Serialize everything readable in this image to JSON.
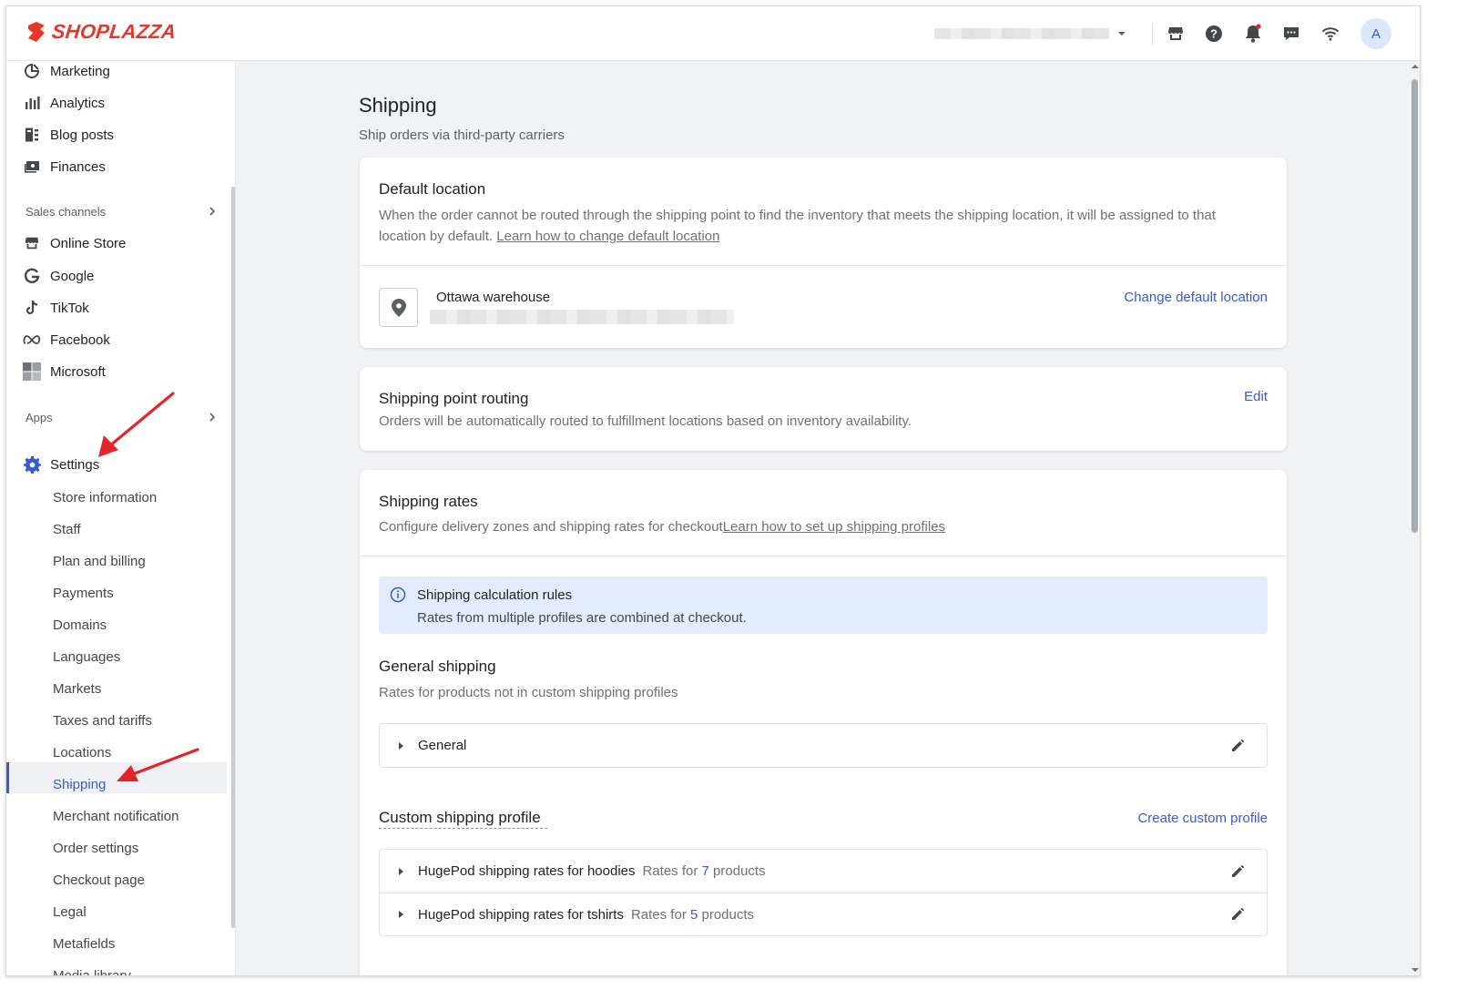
{
  "header": {
    "brand": "SHOPLAZZA",
    "icons": [
      "store-icon",
      "help-icon",
      "notification-icon",
      "chat-icon",
      "wifi-icon"
    ],
    "avatar_initial": "A"
  },
  "sidebar": {
    "items_top": [
      {
        "label": "Marketing",
        "icon": "marketing-icon"
      },
      {
        "label": "Analytics",
        "icon": "analytics-icon"
      },
      {
        "label": "Blog posts",
        "icon": "blog-icon"
      },
      {
        "label": "Finances",
        "icon": "finances-icon"
      }
    ],
    "sales_channels_label": "Sales channels",
    "channels": [
      {
        "label": "Online Store",
        "icon": "store-icon"
      },
      {
        "label": "Google",
        "icon": "google-icon"
      },
      {
        "label": "TikTok",
        "icon": "tiktok-icon"
      },
      {
        "label": "Facebook",
        "icon": "meta-icon"
      },
      {
        "label": "Microsoft",
        "icon": "microsoft-icon"
      }
    ],
    "apps_label": "Apps",
    "settings_label": "Settings",
    "settings_items": [
      "Store information",
      "Staff",
      "Plan and billing",
      "Payments",
      "Domains",
      "Languages",
      "Markets",
      "Taxes and tariffs",
      "Locations",
      "Shipping",
      "Merchant notification",
      "Order settings",
      "Checkout page",
      "Legal",
      "Metafields",
      "Media library"
    ],
    "active_item": "Shipping"
  },
  "page": {
    "title": "Shipping",
    "subtitle": "Ship orders via third-party carriers"
  },
  "default_location": {
    "title": "Default location",
    "description": "When the order cannot be routed through the shipping point to find the inventory that meets the shipping location, it will be assigned to that location by default.",
    "learn_link": "Learn how to change default location",
    "location_name": "Ottawa warehouse",
    "change_link": "Change default location"
  },
  "routing": {
    "title": "Shipping point routing",
    "description": "Orders will be automatically routed to fulfillment locations based on inventory availability.",
    "edit_link": "Edit"
  },
  "rates": {
    "title": "Shipping rates",
    "description": "Configure delivery zones and shipping rates for checkout",
    "learn_link": "Learn how to set up shipping profiles",
    "banner_title": "Shipping calculation rules",
    "banner_text": "Rates from multiple profiles are combined at checkout.",
    "general_title": "General shipping",
    "general_desc": "Rates for products not in custom shipping profiles",
    "general_row": "General",
    "custom_title": "Custom shipping profile",
    "create_link": "Create custom profile",
    "profiles": [
      {
        "name": "HugePod shipping rates for hoodies",
        "prefix": "Rates for",
        "count": "7",
        "suffix": "products"
      },
      {
        "name": "HugePod shipping rates for tshirts",
        "prefix": "Rates for",
        "count": "5",
        "suffix": "products"
      }
    ]
  },
  "colors": {
    "brand": "#e8362a",
    "accent": "#3b5ac9",
    "banner": "#e2ecfc",
    "annotation_arrow": "#e3242b"
  }
}
